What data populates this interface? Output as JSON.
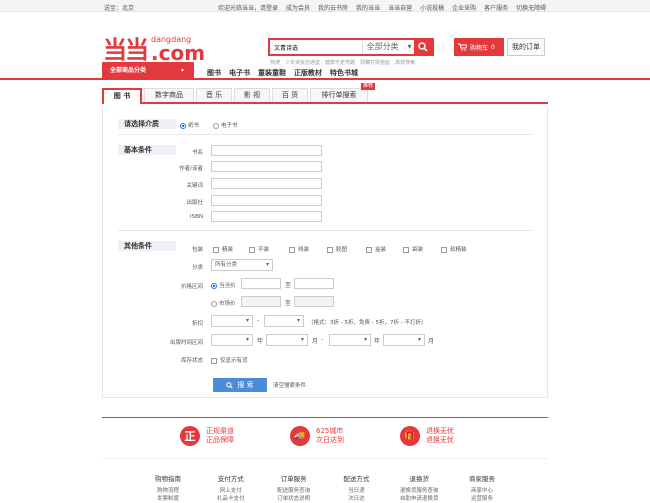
{
  "topbar": {
    "ship_to": "送至：北京",
    "links": [
      "欢迎光临当当，请登录",
      "成为会员",
      "我的云书房",
      "我的当当",
      "当当自营",
      "小说投稿",
      "企业采购",
      "客户服务",
      "切换无障碍"
    ]
  },
  "logo": {
    "mark": "当当",
    "sub": "dangdang",
    "main": ".com"
  },
  "search": {
    "value": "文青诗选",
    "category": "全部分类",
    "hotwords": [
      "热搜",
      "少年读资治通鉴",
      "健康不走弯路",
      "洞察打败拖延",
      "高效搜索"
    ]
  },
  "cart": {
    "label": "购物车",
    "count": "0"
  },
  "orders": {
    "label": "我的订单"
  },
  "nav": {
    "category_button": "全部商品分类",
    "links": [
      "图书",
      "电子书",
      "童装童鞋",
      "正版教材",
      "特色书城"
    ]
  },
  "tabs": [
    {
      "label": "图 书",
      "active": true
    },
    {
      "label": "数字商品"
    },
    {
      "label": "音 乐"
    },
    {
      "label": "影 视"
    },
    {
      "label": "百 货"
    },
    {
      "label": "排行单搜索",
      "badge": "推荐"
    }
  ],
  "form": {
    "medium_title": "请选择介质",
    "medium_options": [
      "纸书",
      "电子书"
    ],
    "basic_title": "基本条件",
    "basic_fields": [
      "书名",
      "作者/译者",
      "关键词",
      "出版社",
      "ISBN"
    ],
    "other_title": "其他条件",
    "binding_label": "包装",
    "binding_options": [
      "精装",
      "平装",
      "线装",
      "胶图",
      "盒装",
      "袋装",
      "软精装"
    ],
    "category_label": "分类",
    "category_value": "所有分类",
    "price_label": "价格区间",
    "price_options": [
      "当当价",
      "市场价"
    ],
    "to": "至",
    "discount_label": "折扣",
    "discount_hint": "（格式：3折 - 5折，免费 - 5折，7折 - 不打折）",
    "date_label": "出版时间区间",
    "year": "年",
    "month": "月",
    "stock_label": "库存状态",
    "stock_option": "仅显示有货",
    "search_button": "搜 索",
    "clear_link": "清空搜索条件"
  },
  "guarantees": [
    {
      "icon": "正",
      "line1": "正规渠道",
      "line2": "正品保障"
    },
    {
      "icon": "🚚",
      "line1": "625城市",
      "line2": "次日达到"
    },
    {
      "icon": "🎁",
      "line1": "退换无忧",
      "line2": "退换无忧"
    }
  ],
  "footer": [
    {
      "title": "购物指南",
      "links": [
        "购物流程",
        "发票制度"
      ]
    },
    {
      "title": "支付方式",
      "links": [
        "网上支付",
        "礼品卡支付"
      ]
    },
    {
      "title": "订单服务",
      "links": [
        "配送服务查询",
        "订单状态说明"
      ]
    },
    {
      "title": "配送方式",
      "links": [
        "当日递",
        "次日达"
      ]
    },
    {
      "title": "退换货",
      "links": [
        "退换货服务查询",
        "自助申请退换货"
      ]
    },
    {
      "title": "商家服务",
      "links": [
        "商家中心",
        "运营服务"
      ]
    }
  ]
}
